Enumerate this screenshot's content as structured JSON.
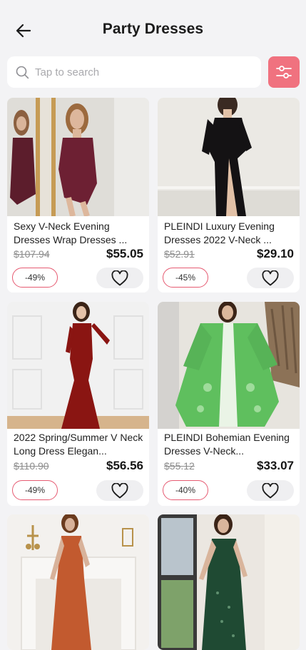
{
  "header": {
    "title": "Party Dresses"
  },
  "search": {
    "placeholder": "Tap to search"
  },
  "products": [
    {
      "name": "Sexy V-Neck Evening Dresses Wrap Dresses ...",
      "old_price": "$107.94",
      "price": "$55.05",
      "discount": "-49%"
    },
    {
      "name": "PLEINDI Luxury Evening Dresses 2022 V-Neck ...",
      "old_price": "$52.91",
      "price": "$29.10",
      "discount": "-45%"
    },
    {
      "name": "2022 Spring/Summer V Neck Long Dress Elegan...",
      "old_price": "$110.90",
      "price": "$56.56",
      "discount": "-49%"
    },
    {
      "name": "PLEINDI Bohemian Evening Dresses V-Neck...",
      "old_price": "$55.12",
      "price": "$33.07",
      "discount": "-40%"
    },
    {
      "name": "",
      "old_price": "",
      "price": "",
      "discount": ""
    },
    {
      "name": "",
      "old_price": "",
      "price": "",
      "discount": ""
    }
  ],
  "colors": {
    "accent": "#f0727f",
    "discount_border": "#e65b72",
    "background": "#f3f3f5"
  },
  "icons": {
    "back": "arrow-left-icon",
    "search": "search-icon",
    "filter": "sliders-icon",
    "favorite": "heart-outline-icon"
  }
}
